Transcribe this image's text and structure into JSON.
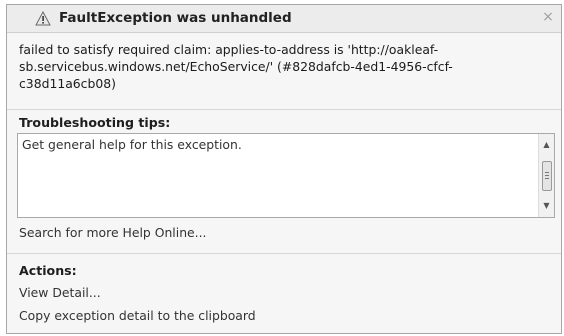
{
  "dialog": {
    "title": "FaultException was unhandled",
    "icon": "warning-icon",
    "close_symbol": "×",
    "message_lines": [
      "failed to satisfy required claim: applies-to-address is 'http://oakleaf-",
      "sb.servicebus.windows.net/EchoService/' (#828dafcb-4ed1-4956-cfcf-",
      "c38d11a6cb08)"
    ]
  },
  "troubleshooting": {
    "heading": "Troubleshooting tips:",
    "tips": [
      "Get general help for this exception."
    ],
    "search_link": "Search for more Help Online..."
  },
  "actions": {
    "heading": "Actions:",
    "items": [
      "View Detail...",
      "Copy exception detail to the clipboard"
    ]
  }
}
